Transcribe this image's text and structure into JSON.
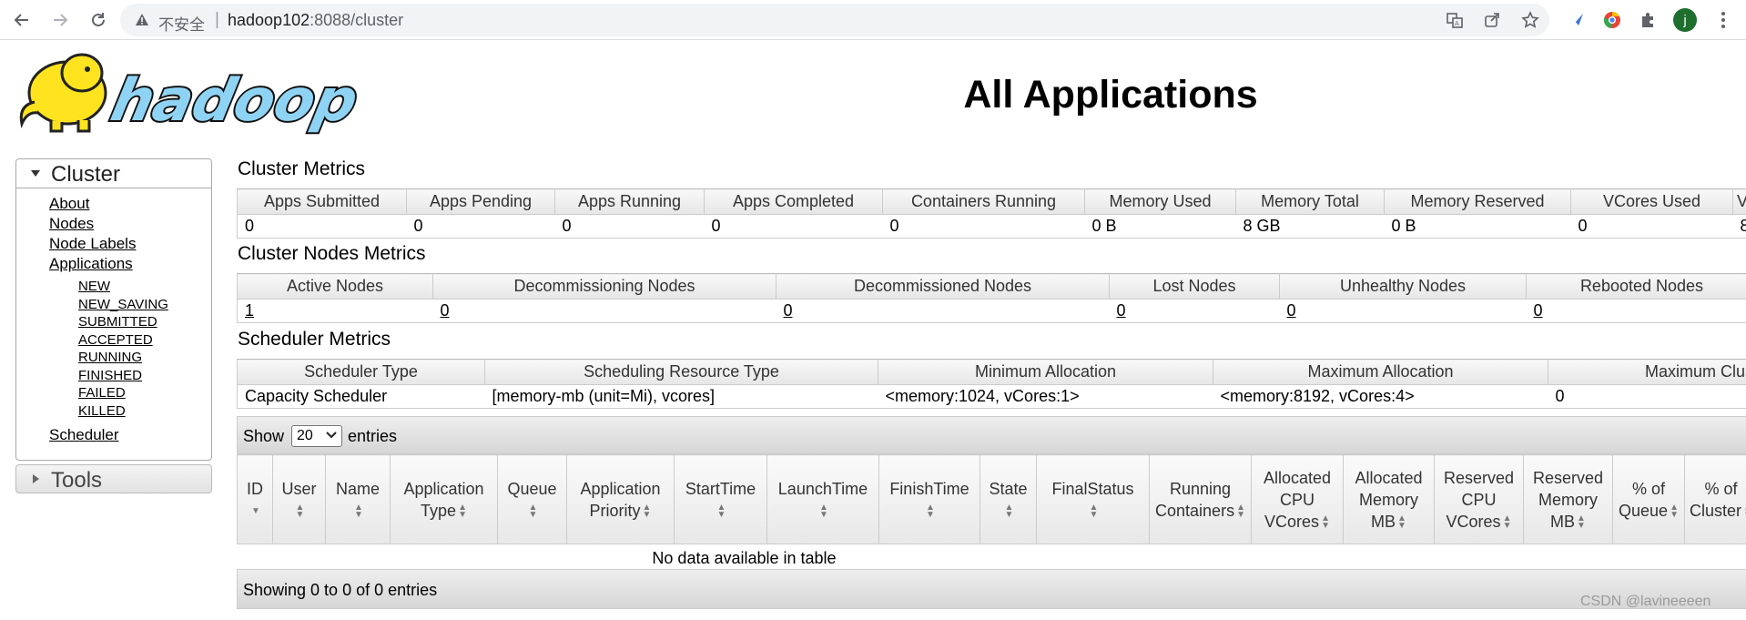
{
  "browser": {
    "insecure_label": "不安全",
    "separator": "|",
    "url_host": "hadoop102",
    "url_rest": ":8088/cluster",
    "profile_initial": "j"
  },
  "page": {
    "title": "All Applications"
  },
  "sidebar": {
    "cluster_label": "Cluster",
    "links": [
      "About",
      "Nodes",
      "Node Labels",
      "Applications"
    ],
    "app_states": [
      "NEW",
      "NEW_SAVING",
      "SUBMITTED",
      "ACCEPTED",
      "RUNNING",
      "FINISHED",
      "FAILED",
      "KILLED"
    ],
    "scheduler_label": "Scheduler",
    "tools_label": "Tools"
  },
  "cluster_metrics": {
    "title": "Cluster Metrics",
    "headers": [
      "Apps Submitted",
      "Apps Pending",
      "Apps Running",
      "Apps Completed",
      "Containers Running",
      "Memory Used",
      "Memory Total",
      "Memory Reserved",
      "VCores Used",
      "VCo"
    ],
    "values": [
      "0",
      "0",
      "0",
      "0",
      "0",
      "0 B",
      "8 GB",
      "0 B",
      "0",
      "8"
    ]
  },
  "nodes_metrics": {
    "title": "Cluster Nodes Metrics",
    "headers": [
      "Active Nodes",
      "Decommissioning Nodes",
      "Decommissioned Nodes",
      "Lost Nodes",
      "Unhealthy Nodes",
      "Rebooted Nodes"
    ],
    "values": [
      "1",
      "0",
      "0",
      "0",
      "0",
      "0"
    ]
  },
  "scheduler_metrics": {
    "title": "Scheduler Metrics",
    "headers": [
      "Scheduler Type",
      "Scheduling Resource Type",
      "Minimum Allocation",
      "Maximum Allocation",
      "Maximum Clus"
    ],
    "values": [
      "Capacity Scheduler",
      "[memory-mb (unit=Mi), vcores]",
      "<memory:1024, vCores:1>",
      "<memory:8192, vCores:4>",
      "0"
    ]
  },
  "apps_table": {
    "show_label": "Show",
    "page_size": "20",
    "entries_label": "entries",
    "columns": [
      "ID",
      "User",
      "Name",
      "Application Type",
      "Queue",
      "Application Priority",
      "StartTime",
      "LaunchTime",
      "FinishTime",
      "State",
      "FinalStatus",
      "Running Containers",
      "Allocated CPU VCores",
      "Allocated Memory MB",
      "Reserved CPU VCores",
      "Reserved Memory MB",
      "% of Queue",
      "% of Cluster"
    ],
    "empty_message": "No data available in table",
    "info": "Showing 0 to 0 of 0 entries"
  },
  "watermark": "CSDN @lavineeeen"
}
